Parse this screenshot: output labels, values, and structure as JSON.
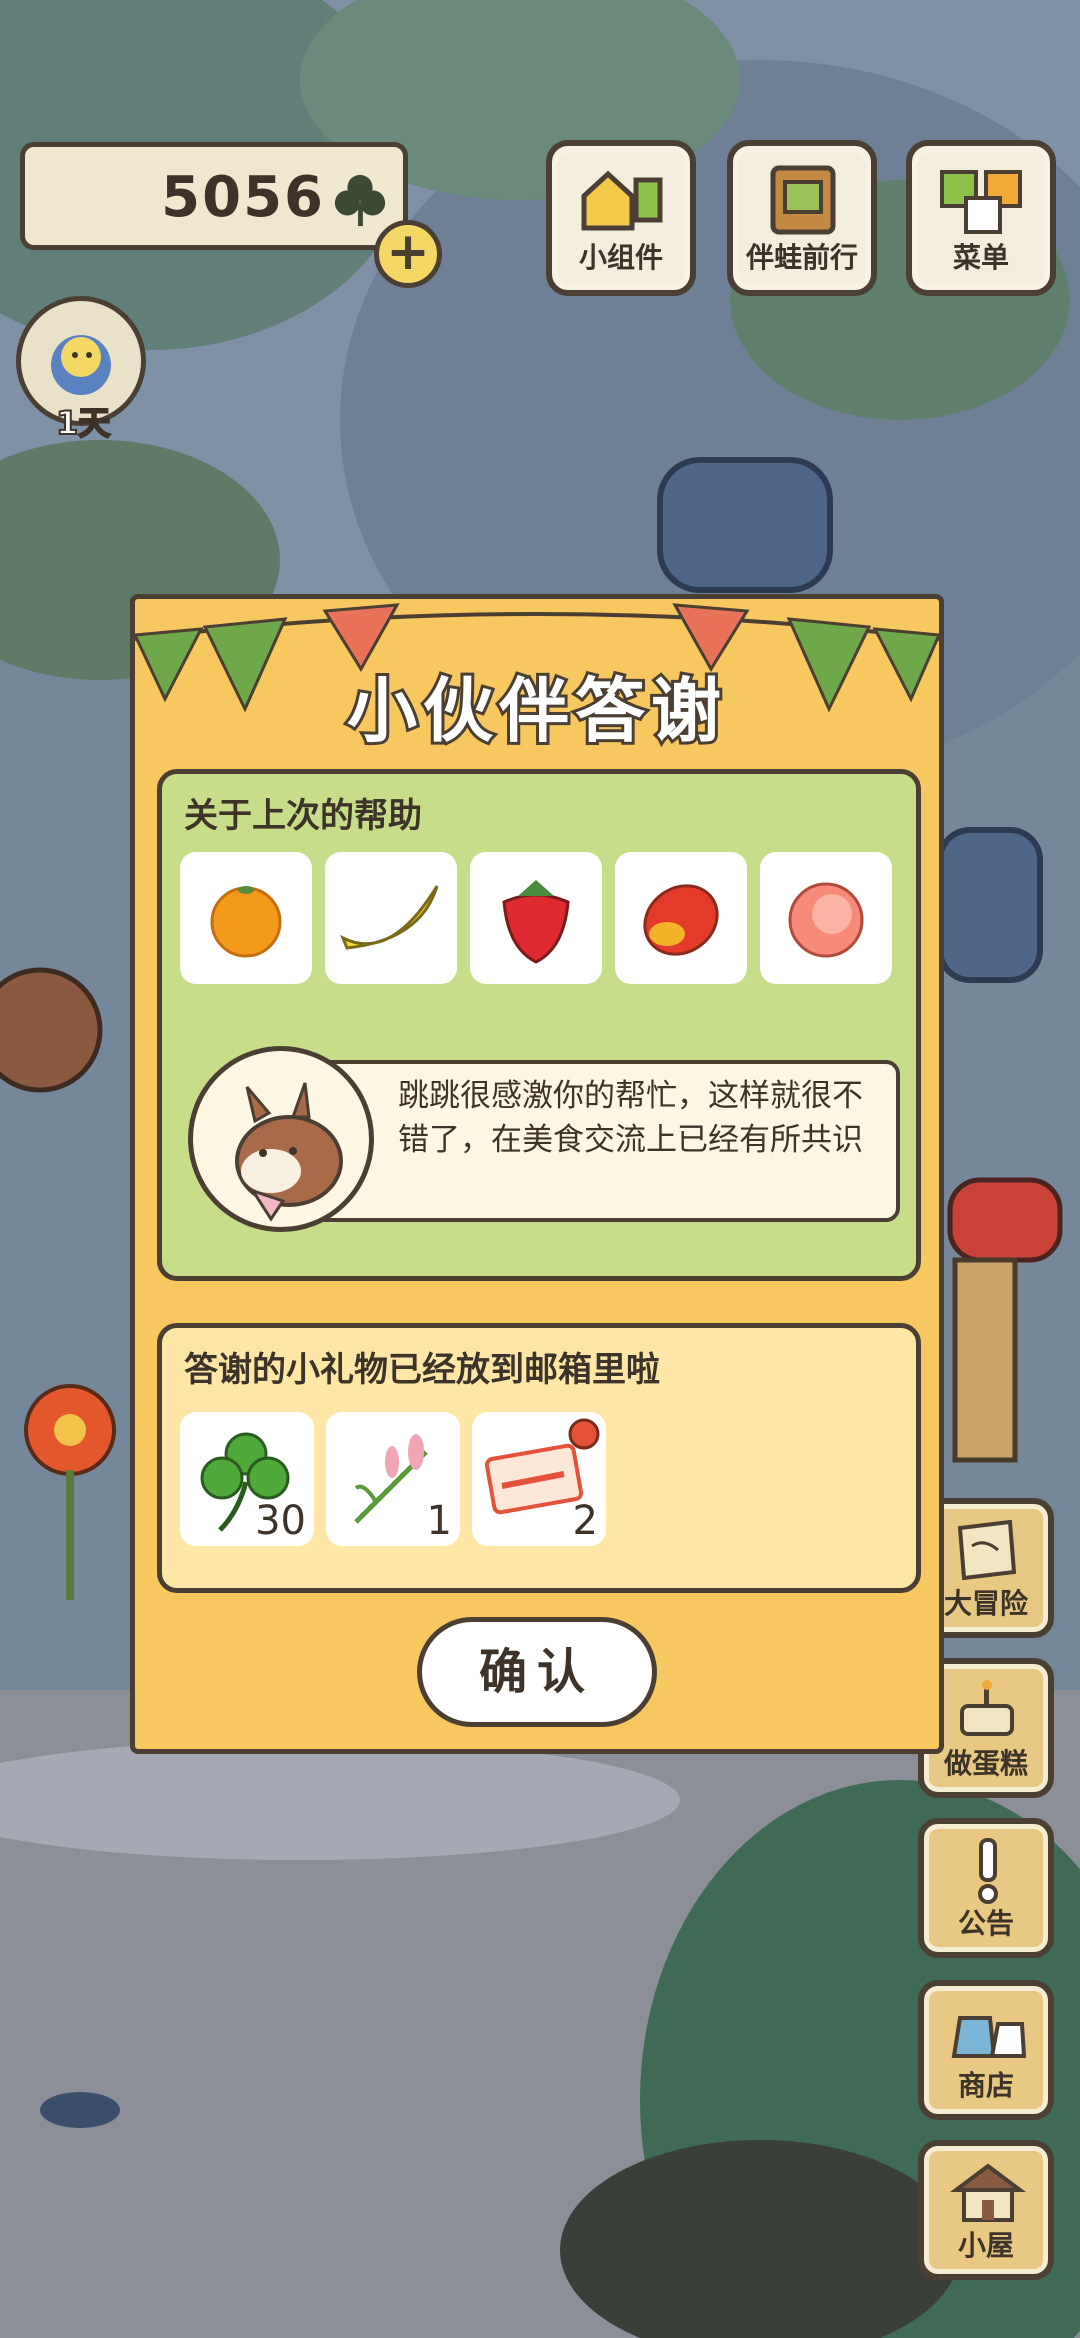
{
  "currency": {
    "value": "5056",
    "icon": "clover-icon"
  },
  "top_menu": [
    {
      "label": "小组件",
      "icon": "widget-icon"
    },
    {
      "label": "伴蛙前行",
      "icon": "album-icon"
    },
    {
      "label": "菜单",
      "icon": "menu-cards-icon"
    }
  ],
  "status": {
    "days": "1天"
  },
  "dialog": {
    "title": "小伙伴答谢",
    "help_heading": "关于上次的帮助",
    "foods": [
      "orange-icon",
      "banana-icon",
      "strawberry-icon",
      "mango-icon",
      "peach-icon"
    ],
    "message": "跳跳很感激你的帮忙，这样就很不错了，在美食交流上已经有所共识",
    "gift_heading": "答谢的小礼物已经放到邮箱里啦",
    "gifts": [
      {
        "icon": "clover-icon",
        "count": "30"
      },
      {
        "icon": "flower-sprig-icon",
        "count": "1"
      },
      {
        "icon": "ticket-icon",
        "count": "2"
      }
    ],
    "confirm": "确认"
  },
  "side_menu": [
    {
      "label": "大冒险",
      "icon": "map-icon"
    },
    {
      "label": "做蛋糕",
      "icon": "cake-icon"
    },
    {
      "label": "公告",
      "icon": "exclamation-icon"
    },
    {
      "label": "商店",
      "icon": "shop-bag-icon"
    },
    {
      "label": "小屋",
      "icon": "house-icon"
    }
  ],
  "colors": {
    "dialog": "#f7c760",
    "panel_green": "#c8dd8a",
    "panel_yellow": "#fde6a6",
    "outline": "#4a3f32"
  }
}
